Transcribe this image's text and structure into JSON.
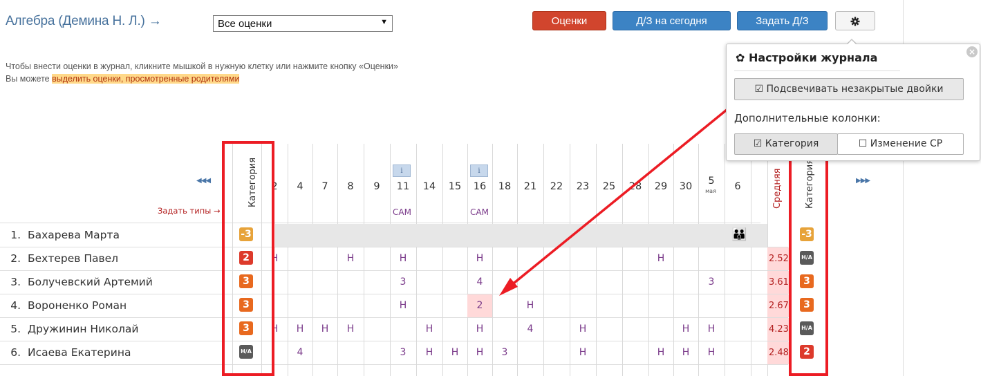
{
  "header": {
    "title": "Алгебра (Демина Н. Л.) →",
    "select_value": "Все оценки",
    "buttons": {
      "grades": "Оценки",
      "hw_today": "Д/З на сегодня",
      "assign_hw": "Задать Д/З"
    }
  },
  "hint": {
    "line1": "Чтобы внести оценки в журнал, кликните мышкой в нужную клетку или нажмите кнопку «Оценки»",
    "line2_prefix": "Вы можете ",
    "line2_link": "выделить оценки, просмотренные родителями"
  },
  "settings_popup": {
    "title": "✿ Настройки журнала",
    "highlight_toggle": "☑ Подсвечивать незакрытые двойки",
    "extra_columns_label": "Дополнительные колонки:",
    "col_category": "☑ Категория",
    "col_change_avg": "☐ Изменение СР"
  },
  "grid": {
    "nav_prev": "◀◀◀",
    "nav_next": "▶▶▶",
    "set_types": "Задать типы →",
    "category_header": "Категория",
    "avg_header": "Средняя",
    "dates": [
      "2",
      "4",
      "7",
      "8",
      "9",
      "11",
      "14",
      "15",
      "16",
      "18",
      "21",
      "22",
      "23",
      "25",
      "28",
      "29",
      "30",
      "5",
      "6"
    ],
    "month_label": "мая",
    "sam_label": "САМ",
    "info_label": "i",
    "students": [
      {
        "num": "1.",
        "name": "Бахарева Марта",
        "cat": "-3",
        "cat2": "-3"
      },
      {
        "num": "2.",
        "name": "Бехтерев  Павел",
        "cat": "2",
        "avg": "2.52",
        "cat2": "Н/А"
      },
      {
        "num": "3.",
        "name": "Болучевский Артемий",
        "cat": "3",
        "avg": "3.61",
        "cat2": "3"
      },
      {
        "num": "4.",
        "name": "Вороненко Роман",
        "cat": "3",
        "avg": "2.67",
        "cat2": "3"
      },
      {
        "num": "5.",
        "name": "Дружинин Николай",
        "cat": "3",
        "avg": "4.23",
        "cat2": "Н/А"
      },
      {
        "num": "6.",
        "name": "Исаева Екатерина",
        "cat": "Н/А",
        "avg": "2.48",
        "cat2": "2"
      }
    ],
    "marks": {
      "r2": [
        "Н",
        "Н",
        "Н",
        "Н",
        "Н"
      ],
      "r3": [
        "3",
        "4",
        "3"
      ],
      "r4": [
        "Н",
        "2",
        "Н"
      ],
      "r5": [
        "Н",
        "Н",
        "Н",
        "Н",
        "Н",
        "Н",
        "4",
        "Н",
        "Н",
        "Н"
      ],
      "r6": [
        "4",
        "3",
        "Н",
        "Н",
        "Н",
        "3",
        "Н",
        "Н",
        "Н",
        "Н"
      ]
    }
  }
}
